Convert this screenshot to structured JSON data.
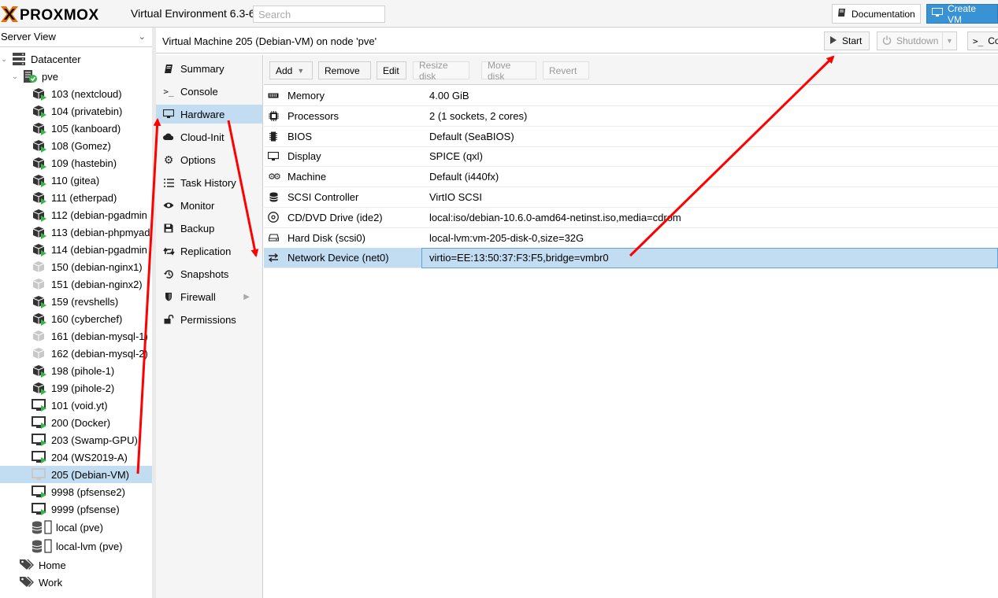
{
  "header": {
    "logo_text": "PROXMOX",
    "version": "Virtual Environment 6.3-6",
    "search_placeholder": "Search",
    "documentation_label": "Documentation",
    "create_vm_label": "Create VM"
  },
  "sidebar": {
    "view": "Server View",
    "datacenter": "Datacenter",
    "node": "pve",
    "guests": [
      {
        "label": "103 (nextcloud)",
        "kind": "ct",
        "running": true
      },
      {
        "label": "104 (privatebin)",
        "kind": "ct",
        "running": true
      },
      {
        "label": "105 (kanboard)",
        "kind": "ct",
        "running": true
      },
      {
        "label": "108 (Gomez)",
        "kind": "ct",
        "running": true
      },
      {
        "label": "109 (hastebin)",
        "kind": "ct",
        "running": true
      },
      {
        "label": "110 (gitea)",
        "kind": "ct",
        "running": true
      },
      {
        "label": "111 (etherpad)",
        "kind": "ct",
        "running": true
      },
      {
        "label": "112 (debian-pgadmin",
        "kind": "ct",
        "running": true
      },
      {
        "label": "113 (debian-phpmyad",
        "kind": "ct",
        "running": true
      },
      {
        "label": "114 (debian-pgadmin",
        "kind": "ct",
        "running": true
      },
      {
        "label": "150 (debian-nginx1)",
        "kind": "ct",
        "running": false
      },
      {
        "label": "151 (debian-nginx2)",
        "kind": "ct",
        "running": false
      },
      {
        "label": "159 (revshells)",
        "kind": "ct",
        "running": true
      },
      {
        "label": "160 (cyberchef)",
        "kind": "ct",
        "running": true
      },
      {
        "label": "161 (debian-mysql-1)",
        "kind": "ct",
        "running": false
      },
      {
        "label": "162 (debian-mysql-2)",
        "kind": "ct",
        "running": false
      },
      {
        "label": "198 (pihole-1)",
        "kind": "ct",
        "running": true
      },
      {
        "label": "199 (pihole-2)",
        "kind": "ct",
        "running": true
      },
      {
        "label": "101 (void.yt)",
        "kind": "vm",
        "running": true
      },
      {
        "label": "200 (Docker)",
        "kind": "vm",
        "running": true
      },
      {
        "label": "203 (Swamp-GPU)",
        "kind": "vm",
        "running": true
      },
      {
        "label": "204 (WS2019-A)",
        "kind": "vm",
        "running": true
      },
      {
        "label": "205 (Debian-VM)",
        "kind": "vm",
        "running": false,
        "selected": true
      },
      {
        "label": "9998 (pfsense2)",
        "kind": "vm",
        "running": true
      },
      {
        "label": "9999 (pfsense)",
        "kind": "vm",
        "running": true
      }
    ],
    "storages": [
      {
        "label": "local (pve)"
      },
      {
        "label": "local-lvm (pve)"
      }
    ],
    "pools": [
      {
        "label": "Home"
      },
      {
        "label": "Work"
      }
    ]
  },
  "vm": {
    "title": "Virtual Machine 205 (Debian-VM) on node 'pve'",
    "start_label": "Start",
    "shutdown_label": "Shutdown",
    "console_label": "Co"
  },
  "nav": [
    {
      "label": "Summary",
      "icon": "book-icon"
    },
    {
      "label": "Console",
      "icon": "terminal-icon"
    },
    {
      "label": "Hardware",
      "icon": "desktop-icon",
      "selected": true
    },
    {
      "label": "Cloud-Init",
      "icon": "cloud-icon"
    },
    {
      "label": "Options",
      "icon": "gear-icon"
    },
    {
      "label": "Task History",
      "icon": "list-icon"
    },
    {
      "label": "Monitor",
      "icon": "eye-icon"
    },
    {
      "label": "Backup",
      "icon": "floppy-icon"
    },
    {
      "label": "Replication",
      "icon": "retweet-icon"
    },
    {
      "label": "Snapshots",
      "icon": "history-icon"
    },
    {
      "label": "Firewall",
      "icon": "shield-icon",
      "has_submenu": true
    },
    {
      "label": "Permissions",
      "icon": "unlock-icon"
    }
  ],
  "toolbar": {
    "add": "Add",
    "remove": "Remove",
    "edit": "Edit",
    "resize": "Resize disk",
    "move": "Move disk",
    "revert": "Revert"
  },
  "hardware": [
    {
      "name": "Memory",
      "value": "4.00 GiB",
      "icon": "memory-icon"
    },
    {
      "name": "Processors",
      "value": "2 (1 sockets, 2 cores)",
      "icon": "cpu-icon"
    },
    {
      "name": "BIOS",
      "value": "Default (SeaBIOS)",
      "icon": "chip-icon"
    },
    {
      "name": "Display",
      "value": "SPICE (qxl)",
      "icon": "desktop-icon"
    },
    {
      "name": "Machine",
      "value": "Default (i440fx)",
      "icon": "cogs-icon"
    },
    {
      "name": "SCSI Controller",
      "value": "VirtIO SCSI",
      "icon": "database-icon"
    },
    {
      "name": "CD/DVD Drive (ide2)",
      "value": "local:iso/debian-10.6.0-amd64-netinst.iso,media=cdrom",
      "icon": "cdrom-icon"
    },
    {
      "name": "Hard Disk (scsi0)",
      "value": "local-lvm:vm-205-disk-0,size=32G",
      "icon": "hdd-icon"
    },
    {
      "name": "Network Device (net0)",
      "value": "virtio=EE:13:50:37:F3:F5,bridge=vmbr0",
      "icon": "exchange-icon",
      "selected": true
    }
  ],
  "colors": {
    "accent": "#3892d4",
    "selection": "#c2ddf2",
    "running": "#3bb44a",
    "logo_orange": "#e57000",
    "annotation": "#ff0000"
  }
}
